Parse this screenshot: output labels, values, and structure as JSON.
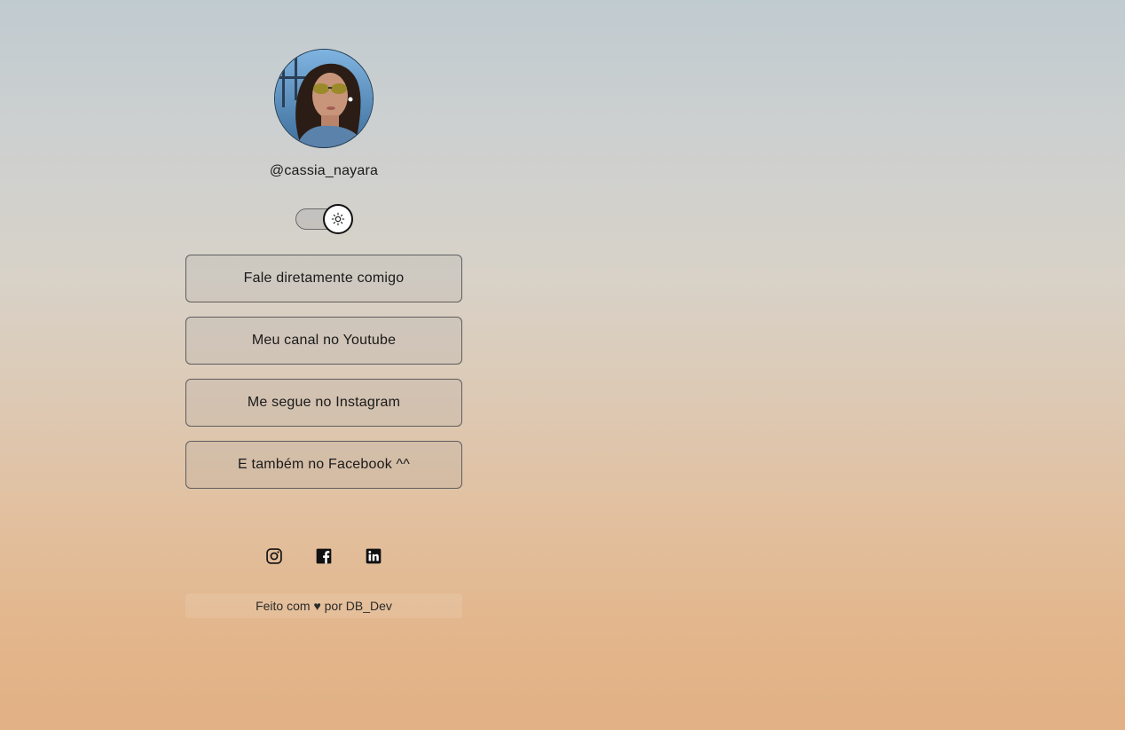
{
  "profile": {
    "username": "@cassia_nayara",
    "avatar_icon": "profile-photo"
  },
  "theme_switch": {
    "icon": "sun-icon",
    "state": "light"
  },
  "links": [
    {
      "label": "Fale diretamente comigo"
    },
    {
      "label": "Meu canal no Youtube"
    },
    {
      "label": "Me segue no Instagram"
    },
    {
      "label": "E também no Facebook ^^"
    }
  ],
  "social": [
    {
      "icon": "instagram-icon"
    },
    {
      "icon": "facebook-icon"
    },
    {
      "icon": "linkedin-icon"
    }
  ],
  "footer": {
    "prefix": "Feito com ",
    "heart": "♥",
    "suffix": " por DB_Dev"
  },
  "colors": {
    "background_top": "#c0cbd0",
    "background_bottom": "#e2b185",
    "button_border": "#5e5e5e",
    "text": "#1a1a1a"
  }
}
